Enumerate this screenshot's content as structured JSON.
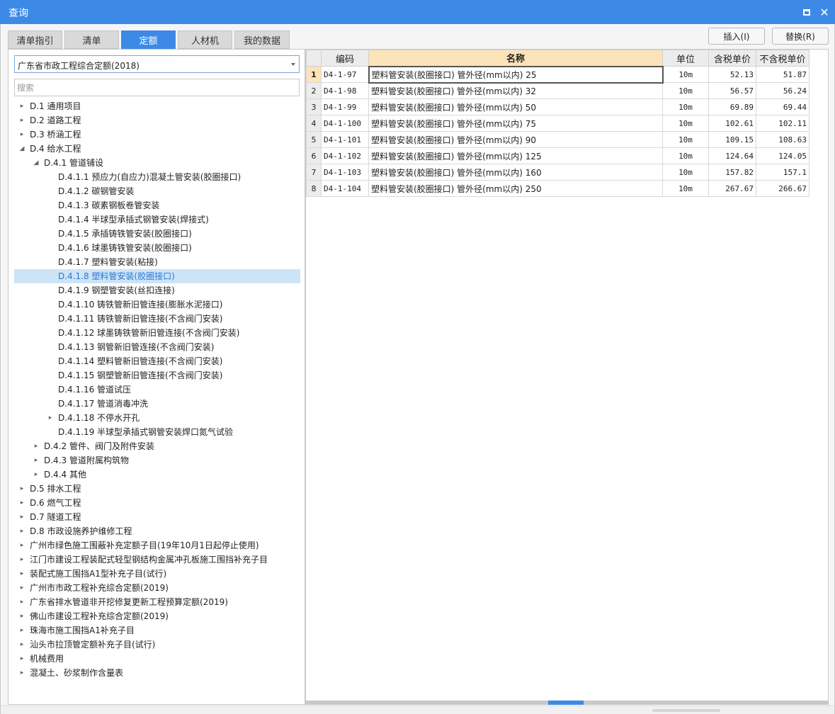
{
  "window": {
    "title": "查询"
  },
  "tabs": [
    "清单指引",
    "清单",
    "定额",
    "人材机",
    "我的数据"
  ],
  "active_tab": "定额",
  "actions": {
    "insert": "插入(I)",
    "replace": "替换(R)"
  },
  "left": {
    "combo_value": "广东省市政工程综合定额(2018)",
    "search_placeholder": "搜索",
    "tree": [
      {
        "label": "D.1 通用项目",
        "level": 0,
        "twisty": "collapsed"
      },
      {
        "label": "D.2 道路工程",
        "level": 0,
        "twisty": "collapsed"
      },
      {
        "label": "D.3 桥涵工程",
        "level": 0,
        "twisty": "collapsed"
      },
      {
        "label": "D.4 给水工程",
        "level": 0,
        "twisty": "expanded"
      },
      {
        "label": "D.4.1 管道铺设",
        "level": 1,
        "twisty": "expanded"
      },
      {
        "label": "D.4.1.1 预应力(自应力)混凝土管安装(胶圈接口)",
        "level": 2,
        "twisty": "none"
      },
      {
        "label": "D.4.1.2 碳钢管安装",
        "level": 2,
        "twisty": "none"
      },
      {
        "label": "D.4.1.3 碳素钢板卷管安装",
        "level": 2,
        "twisty": "none"
      },
      {
        "label": "D.4.1.4 半球型承插式钢管安装(焊接式)",
        "level": 2,
        "twisty": "none"
      },
      {
        "label": "D.4.1.5 承插铸铁管安装(胶圈接口)",
        "level": 2,
        "twisty": "none"
      },
      {
        "label": "D.4.1.6 球墨铸铁管安装(胶圈接口)",
        "level": 2,
        "twisty": "none"
      },
      {
        "label": "D.4.1.7 塑料管安装(粘接)",
        "level": 2,
        "twisty": "none"
      },
      {
        "label": "D.4.1.8 塑料管安装(胶圈接口)",
        "level": 2,
        "twisty": "none",
        "selected": true
      },
      {
        "label": "D.4.1.9 钢塑管安装(丝扣连接)",
        "level": 2,
        "twisty": "none"
      },
      {
        "label": "D.4.1.10 铸铁管新旧管连接(膨胀水泥接口)",
        "level": 2,
        "twisty": "none"
      },
      {
        "label": "D.4.1.11 铸铁管新旧管连接(不含阀门安装)",
        "level": 2,
        "twisty": "none"
      },
      {
        "label": "D.4.1.12 球墨铸铁管新旧管连接(不含阀门安装)",
        "level": 2,
        "twisty": "none"
      },
      {
        "label": "D.4.1.13 钢管新旧管连接(不含阀门安装)",
        "level": 2,
        "twisty": "none"
      },
      {
        "label": "D.4.1.14 塑料管新旧管连接(不含阀门安装)",
        "level": 2,
        "twisty": "none"
      },
      {
        "label": "D.4.1.15 钢塑管新旧管连接(不含阀门安装)",
        "level": 2,
        "twisty": "none"
      },
      {
        "label": "D.4.1.16 管道试压",
        "level": 2,
        "twisty": "none"
      },
      {
        "label": "D.4.1.17 管道消毒冲洗",
        "level": 2,
        "twisty": "none"
      },
      {
        "label": "D.4.1.18 不停水开孔",
        "level": 2,
        "twisty": "collapsed"
      },
      {
        "label": "D.4.1.19 半球型承插式钢管安装焊口氮气试验",
        "level": 2,
        "twisty": "none"
      },
      {
        "label": "D.4.2 管件、阀门及附件安装",
        "level": 1,
        "twisty": "collapsed"
      },
      {
        "label": "D.4.3 管道附属构筑物",
        "level": 1,
        "twisty": "collapsed"
      },
      {
        "label": "D.4.4 其他",
        "level": 1,
        "twisty": "collapsed"
      },
      {
        "label": "D.5 排水工程",
        "level": 0,
        "twisty": "collapsed"
      },
      {
        "label": "D.6 燃气工程",
        "level": 0,
        "twisty": "collapsed"
      },
      {
        "label": "D.7 隧道工程",
        "level": 0,
        "twisty": "collapsed"
      },
      {
        "label": "D.8 市政设施养护维修工程",
        "level": 0,
        "twisty": "collapsed"
      },
      {
        "label": "广州市绿色施工围蔽补充定额子目(19年10月1日起停止使用)",
        "level": 0,
        "twisty": "collapsed"
      },
      {
        "label": "江门市建设工程装配式轻型钢结构金属冲孔板施工围挡补充子目",
        "level": 0,
        "twisty": "collapsed"
      },
      {
        "label": "装配式施工围挡A1型补充子目(试行)",
        "level": 0,
        "twisty": "collapsed"
      },
      {
        "label": "广州市市政工程补充综合定额(2019)",
        "level": 0,
        "twisty": "collapsed"
      },
      {
        "label": "广东省排水管道非开挖修复更新工程预算定额(2019)",
        "level": 0,
        "twisty": "collapsed"
      },
      {
        "label": "佛山市建设工程补充综合定额(2019)",
        "level": 0,
        "twisty": "collapsed"
      },
      {
        "label": "珠海市施工围挡A1补充子目",
        "level": 0,
        "twisty": "collapsed"
      },
      {
        "label": "汕头市拉顶管定额补充子目(试行)",
        "level": 0,
        "twisty": "collapsed"
      },
      {
        "label": "机械费用",
        "level": 0,
        "twisty": "collapsed"
      },
      {
        "label": "混凝土、砂浆制作含量表",
        "level": 0,
        "twisty": "collapsed"
      }
    ]
  },
  "table": {
    "headers": {
      "code": "编码",
      "name": "名称",
      "unit": "单位",
      "tax_price": "含税单价",
      "notax_price": "不含税单价"
    },
    "rows": [
      {
        "num": "1",
        "code": "D4-1-97",
        "name": "塑料管安装(胶圈接口) 管外径(mm以内) 25",
        "unit": "10m",
        "tax_price": "52.13",
        "notax_price": "51.87"
      },
      {
        "num": "2",
        "code": "D4-1-98",
        "name": "塑料管安装(胶圈接口) 管外径(mm以内) 32",
        "unit": "10m",
        "tax_price": "56.57",
        "notax_price": "56.24"
      },
      {
        "num": "3",
        "code": "D4-1-99",
        "name": "塑料管安装(胶圈接口) 管外径(mm以内) 50",
        "unit": "10m",
        "tax_price": "69.89",
        "notax_price": "69.44"
      },
      {
        "num": "4",
        "code": "D4-1-100",
        "name": "塑料管安装(胶圈接口) 管外径(mm以内) 75",
        "unit": "10m",
        "tax_price": "102.61",
        "notax_price": "102.11"
      },
      {
        "num": "5",
        "code": "D4-1-101",
        "name": "塑料管安装(胶圈接口) 管外径(mm以内) 90",
        "unit": "10m",
        "tax_price": "109.15",
        "notax_price": "108.63"
      },
      {
        "num": "6",
        "code": "D4-1-102",
        "name": "塑料管安装(胶圈接口) 管外径(mm以内) 125",
        "unit": "10m",
        "tax_price": "124.64",
        "notax_price": "124.05"
      },
      {
        "num": "7",
        "code": "D4-1-103",
        "name": "塑料管安装(胶圈接口) 管外径(mm以内) 160",
        "unit": "10m",
        "tax_price": "157.82",
        "notax_price": "157.1"
      },
      {
        "num": "8",
        "code": "D4-1-104",
        "name": "塑料管安装(胶圈接口) 管外径(mm以内) 250",
        "unit": "10m",
        "tax_price": "267.67",
        "notax_price": "266.67"
      }
    ]
  },
  "colors": {
    "accent": "#3c8ae6",
    "header_highlight": "#fde3b8",
    "selection": "#cde4f7"
  }
}
